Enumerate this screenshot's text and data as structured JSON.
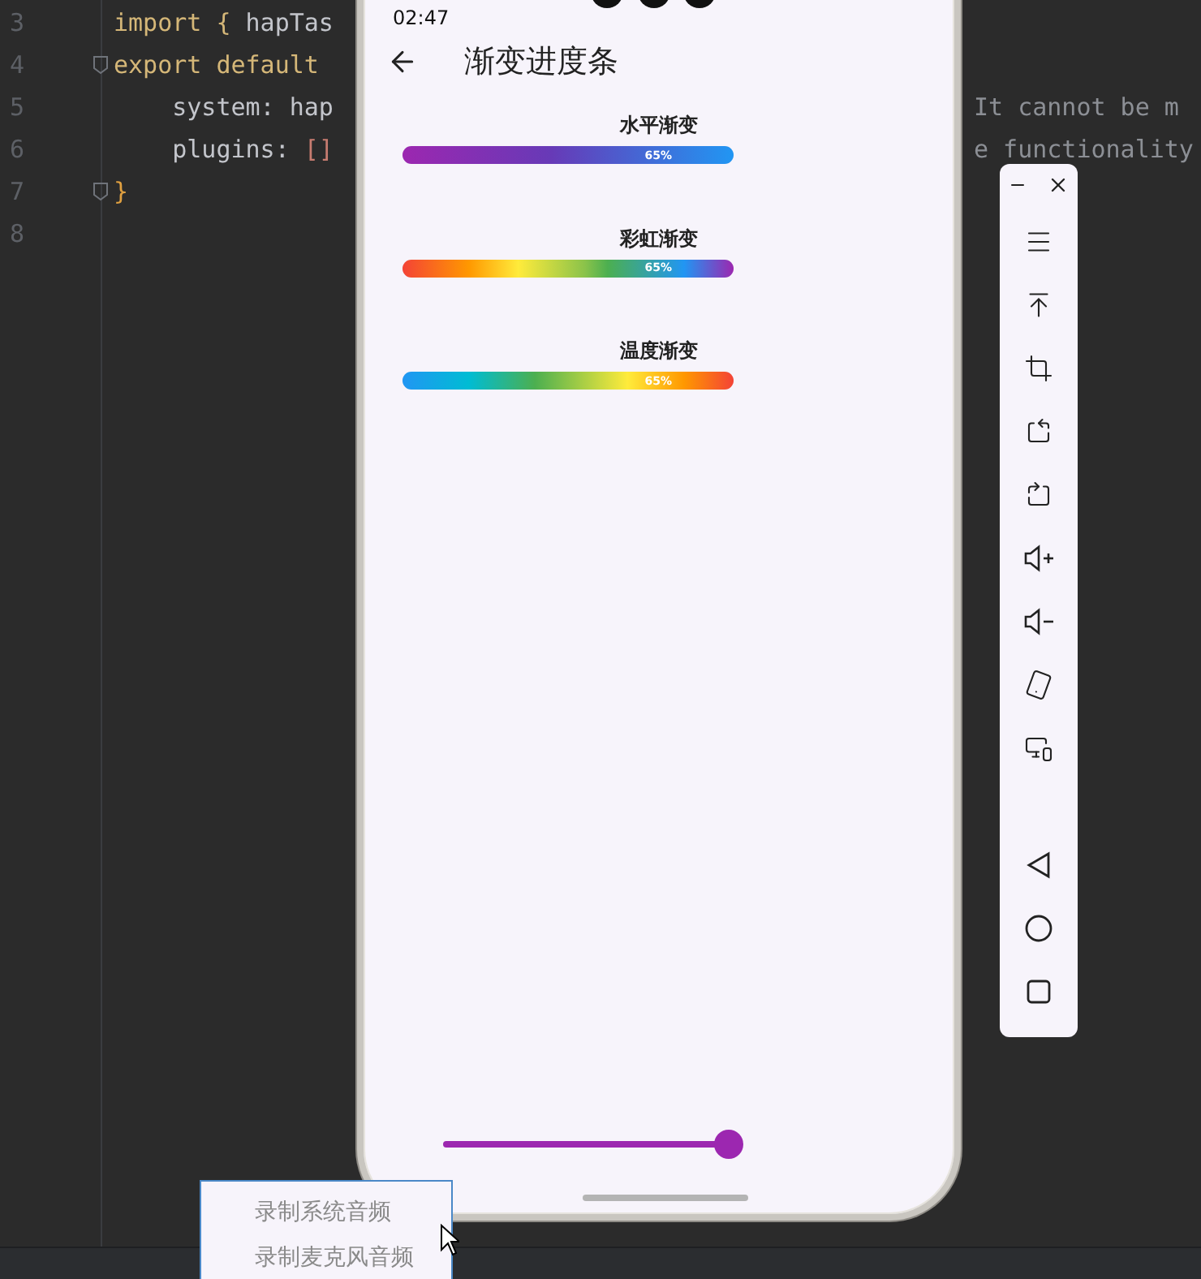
{
  "editor": {
    "lines": [
      {
        "number": "3",
        "tokens": [
          {
            "kind": "keyword",
            "text": "import"
          },
          {
            "kind": "bracket",
            "text": " {"
          },
          {
            "kind": "plain",
            "text": " hapTas"
          }
        ],
        "fold": false
      },
      {
        "number": "4",
        "tokens": [
          {
            "kind": "keyword",
            "text": "export default"
          }
        ],
        "fold": true
      },
      {
        "number": "5",
        "tokens": [
          {
            "kind": "plain",
            "text": "    system: hap"
          }
        ],
        "comment": "It cannot be m",
        "fold": false
      },
      {
        "number": "6",
        "tokens": [
          {
            "kind": "plain",
            "text": "    plugins: "
          },
          {
            "kind": "array",
            "text": "[]"
          }
        ],
        "comment": "e functionality",
        "fold": false
      },
      {
        "number": "7",
        "tokens": [
          {
            "kind": "brace",
            "text": "}"
          }
        ],
        "fold": true
      },
      {
        "number": "8",
        "fold": false
      }
    ]
  },
  "phone": {
    "time": "02:47",
    "title": "渐变进度条",
    "bars": [
      {
        "label": "水平渐变",
        "kind": "horizontal",
        "percent": "65%",
        "level": 1
      },
      {
        "label": "彩虹渐变",
        "kind": "rainbow",
        "percent": "65%",
        "level": 1
      },
      {
        "label": "温度渐变",
        "kind": "temperature",
        "percent": "65%",
        "level": 1
      }
    ],
    "slider": {
      "level": 0.66
    }
  },
  "popup_menu": {
    "items": [
      "录制系统音频",
      "录制麦克风音频"
    ]
  }
}
